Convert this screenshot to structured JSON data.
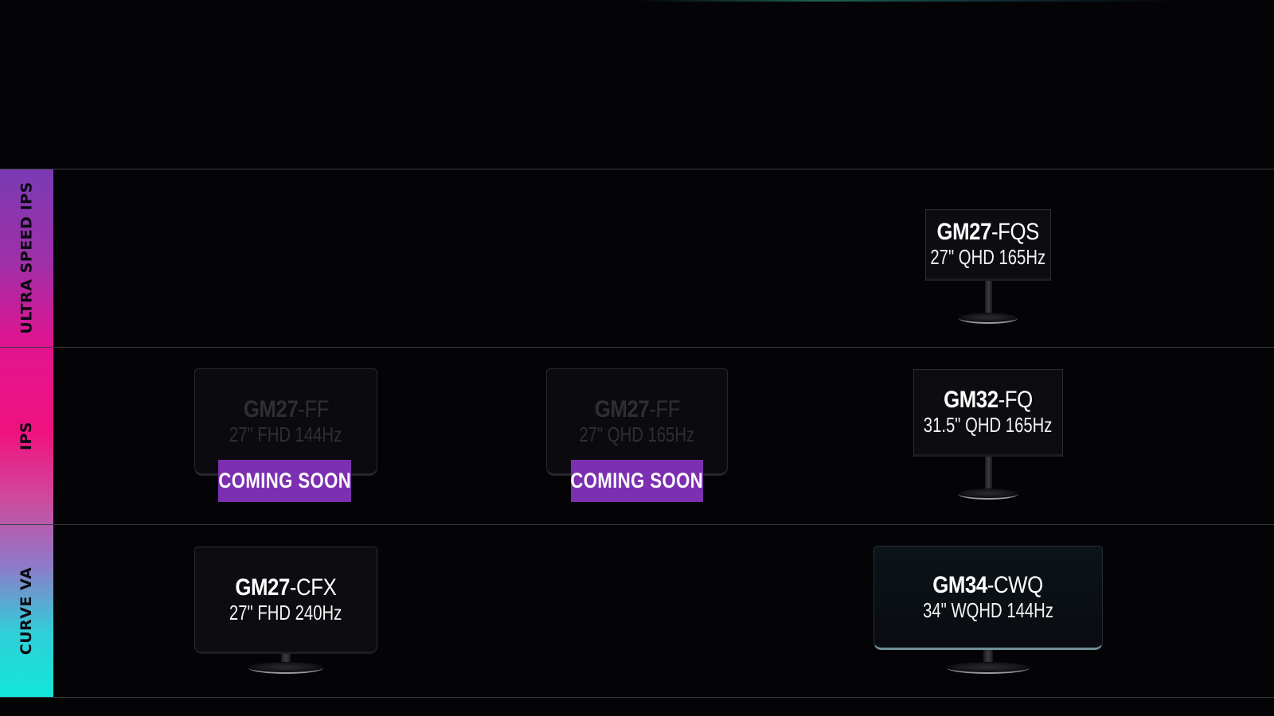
{
  "rows": [
    {
      "label": "ULTRA SPEED IPS"
    },
    {
      "label": "IPS"
    },
    {
      "label": "CURVE VA"
    }
  ],
  "products": [
    {
      "model_prefix": "GM27",
      "model_suffix": "-FQS",
      "spec": "27\" QHD 165Hz",
      "status": "available"
    },
    {
      "model_prefix": "GM27",
      "model_suffix": "-FF",
      "spec": "27\" FHD 144Hz",
      "status": "coming-soon",
      "badge": "COMING SOON"
    },
    {
      "model_prefix": "GM27",
      "model_suffix": "-FF",
      "spec": "27\" QHD 165Hz",
      "status": "coming-soon",
      "badge": "COMING SOON"
    },
    {
      "model_prefix": "GM32",
      "model_suffix": "-FQ",
      "spec": "31.5\" QHD 165Hz",
      "status": "available"
    },
    {
      "model_prefix": "GM27",
      "model_suffix": "-CFX",
      "spec": "27\" FHD 240Hz",
      "status": "available"
    },
    {
      "model_prefix": "GM34",
      "model_suffix": "-CWQ",
      "spec": "34\" WQHD 144Hz",
      "status": "available"
    }
  ],
  "colors": {
    "background": "#040407",
    "badge": "#7c2fb0",
    "sidebar_top": "#7a3bb3",
    "sidebar_mid": "#f0127f",
    "sidebar_bottom": "#12e6d9"
  },
  "icons": [
    "monitor-icon"
  ]
}
